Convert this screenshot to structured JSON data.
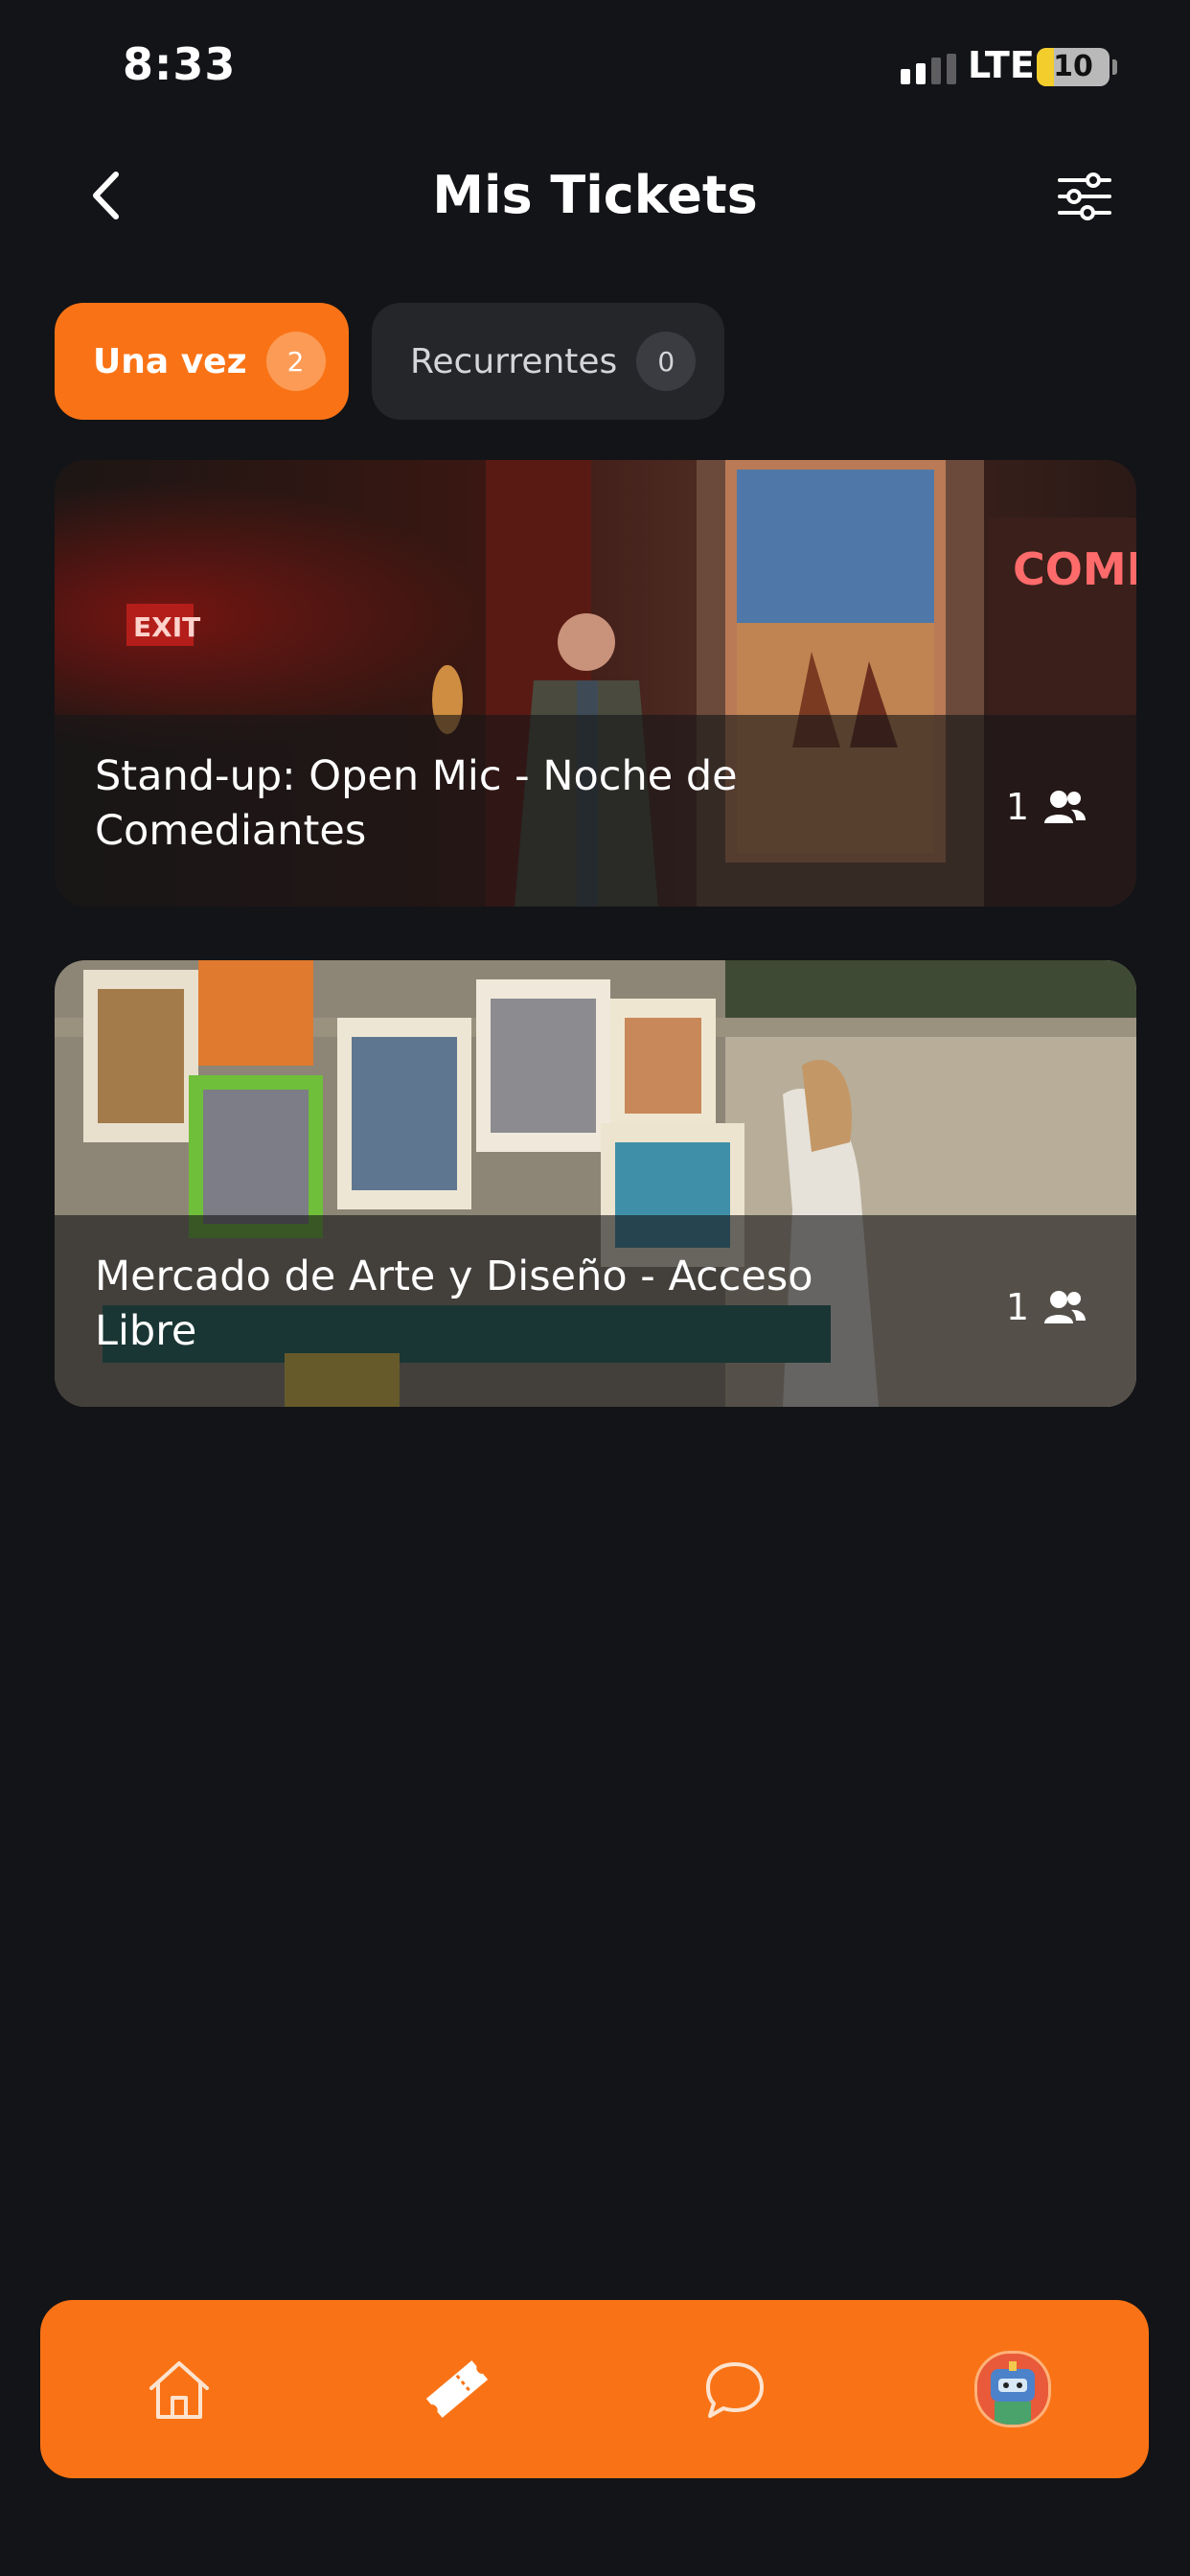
{
  "status_bar": {
    "time": "8:33",
    "network": "LTE",
    "battery": "10"
  },
  "header": {
    "title": "Mis Tickets",
    "back_icon": "chevron-left-icon",
    "filter_icon": "sliders-icon"
  },
  "tabs": [
    {
      "label": "Una vez",
      "count": "2",
      "active": true
    },
    {
      "label": "Recurrentes",
      "count": "0",
      "active": false
    }
  ],
  "events": [
    {
      "title": "Stand-up: Open Mic - Noche de Comediantes",
      "attendees": "1",
      "image": "comedy-club-photo"
    },
    {
      "title": "Mercado de Arte y Diseño - Acceso Libre",
      "attendees": "1",
      "image": "art-market-photo"
    }
  ],
  "bottom_nav": [
    {
      "name": "home",
      "icon": "home-icon"
    },
    {
      "name": "tickets",
      "icon": "ticket-icon",
      "active": true
    },
    {
      "name": "chat",
      "icon": "chat-icon"
    },
    {
      "name": "profile",
      "icon": "avatar"
    }
  ],
  "colors": {
    "accent": "#f97316",
    "background": "#131417",
    "tab_inactive": "#24262a"
  }
}
